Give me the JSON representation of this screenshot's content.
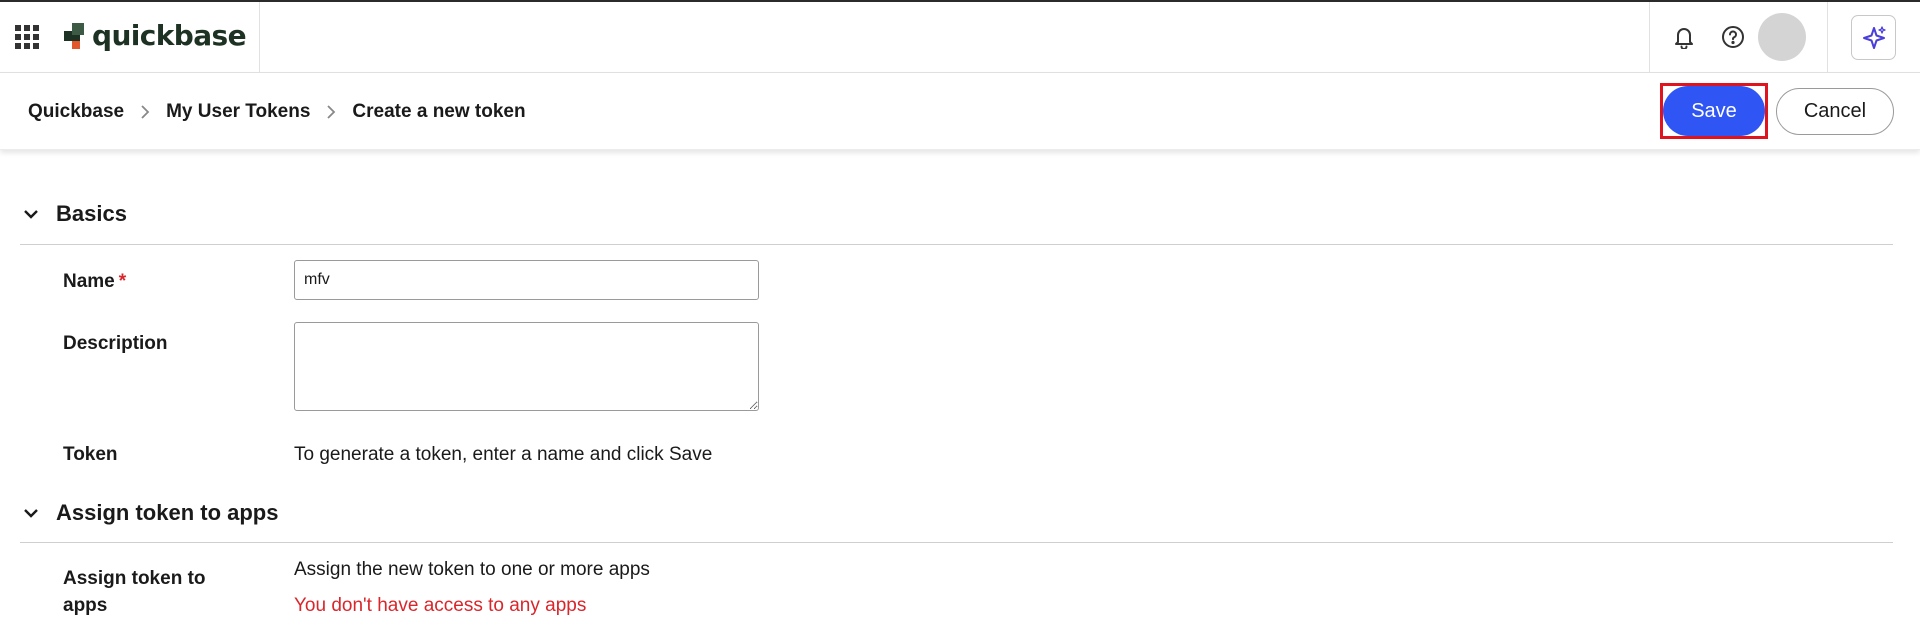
{
  "topbar": {
    "apps_icon": "grid-icon",
    "logo_text": "quickbase",
    "notifications_icon": "bell-icon",
    "help_icon": "help-circle-icon",
    "ai_icon": "sparkle-icon"
  },
  "breadcrumb": {
    "items": [
      "Quickbase",
      "My User Tokens",
      "Create a new token"
    ],
    "separator_icon": "chevron-right-icon"
  },
  "actions": {
    "save_label": "Save",
    "cancel_label": "Cancel"
  },
  "sections": {
    "basics": {
      "title": "Basics",
      "name_label": "Name",
      "required_marker": "*",
      "name_value": "mfv",
      "description_label": "Description",
      "description_value": "",
      "token_label": "Token",
      "token_text": "To generate a token, enter a name and click Save"
    },
    "assign": {
      "title": "Assign token to apps",
      "label": "Assign token to apps",
      "info_text": "Assign the new token to one or more apps",
      "error_text": "You don't have access to any apps"
    }
  },
  "colors": {
    "primary": "#2f55f5",
    "error": "#d9262b",
    "highlight": "#e0141e",
    "logo_dark": "#1d3223",
    "logo_orange": "#e2572b",
    "ai_purple": "#4b3fd9"
  }
}
